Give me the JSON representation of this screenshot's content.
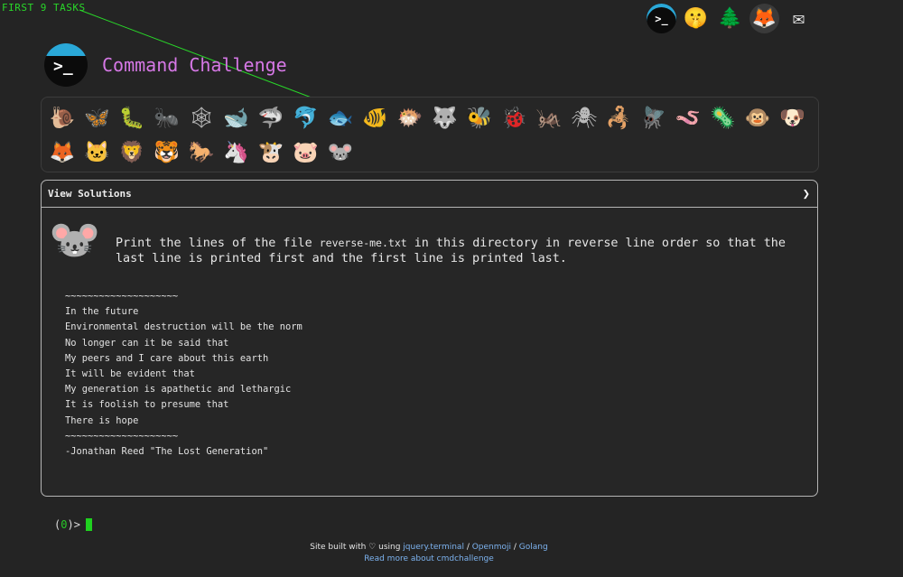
{
  "annotation": {
    "label": "FIRST 9 TASKS",
    "color": "#29d629"
  },
  "header": {
    "title": "Command Challenge",
    "title_color": "#d678e6",
    "top_icons": [
      {
        "name": "terminal-icon",
        "glyph": ">_"
      },
      {
        "name": "shushing-face-icon",
        "glyph": "🤫"
      },
      {
        "name": "tree-icon",
        "glyph": "🌲"
      },
      {
        "name": "gitlab-icon",
        "glyph": "🦊"
      },
      {
        "name": "envelope-icon",
        "glyph": "✉"
      }
    ]
  },
  "tasks": [
    {
      "name": "snail",
      "glyph": "🐌"
    },
    {
      "name": "butterfly",
      "glyph": "🦋"
    },
    {
      "name": "caterpillar",
      "glyph": "🐛"
    },
    {
      "name": "ant",
      "glyph": "🐜"
    },
    {
      "name": "spider-web",
      "glyph": "🕸"
    },
    {
      "name": "whale",
      "glyph": "🐋"
    },
    {
      "name": "shark",
      "glyph": "🦈"
    },
    {
      "name": "dolphin",
      "glyph": "🐬"
    },
    {
      "name": "fish",
      "glyph": "🐟"
    },
    {
      "name": "tropical-fish",
      "glyph": "🐠"
    },
    {
      "name": "blowfish",
      "glyph": "🐡"
    },
    {
      "name": "wolf",
      "glyph": "🐺"
    },
    {
      "name": "bee",
      "glyph": "🐝"
    },
    {
      "name": "lady-beetle",
      "glyph": "🐞"
    },
    {
      "name": "cricket",
      "glyph": "🦗"
    },
    {
      "name": "spider",
      "glyph": "🕷"
    },
    {
      "name": "scorpion",
      "glyph": "🦂"
    },
    {
      "name": "fly",
      "glyph": "🪰"
    },
    {
      "name": "worm",
      "glyph": "🪱"
    },
    {
      "name": "microbe",
      "glyph": "🦠"
    },
    {
      "name": "monkey",
      "glyph": "🐵"
    },
    {
      "name": "dog",
      "glyph": "🐶"
    },
    {
      "name": "fox",
      "glyph": "🦊"
    },
    {
      "name": "cat",
      "glyph": "🐱"
    },
    {
      "name": "lion",
      "glyph": "🦁"
    },
    {
      "name": "tiger",
      "glyph": "🐯"
    },
    {
      "name": "horse",
      "glyph": "🐎"
    },
    {
      "name": "unicorn",
      "glyph": "🦄"
    },
    {
      "name": "cow",
      "glyph": "🐮"
    },
    {
      "name": "pig",
      "glyph": "🐷"
    },
    {
      "name": "mouse",
      "glyph": "🐭"
    }
  ],
  "solutions": {
    "title": "View Solutions",
    "chevron": "❯",
    "challenge_icon": "🐭",
    "challenge_before": "Print the lines of the file ",
    "challenge_file": "reverse-me.txt",
    "challenge_after": " in this directory in reverse line order so that the last line is printed first and the first line is printed last.",
    "poem": [
      "~~~~~~~~~~~~~~~~~~~~",
      "In the future",
      "Environmental destruction will be the norm",
      "No longer can it be said that",
      "My peers and I care about this earth",
      "It will be evident that",
      "My generation is apathetic and lethargic",
      "It is foolish to presume that",
      "There is hope",
      "~~~~~~~~~~~~~~~~~~~~",
      "-Jonathan Reed \"The Lost Generation\""
    ]
  },
  "prompt": {
    "open": "(",
    "code": "0",
    "close": ")>"
  },
  "footer": {
    "built_with": "Site built with ♡ using ",
    "link_jquery": "jquery.terminal",
    "sep1": " / ",
    "link_openmoji": "Openmoji",
    "sep2": " / ",
    "link_golang": "Golang",
    "read_more": "Read more about cmdchallenge"
  }
}
